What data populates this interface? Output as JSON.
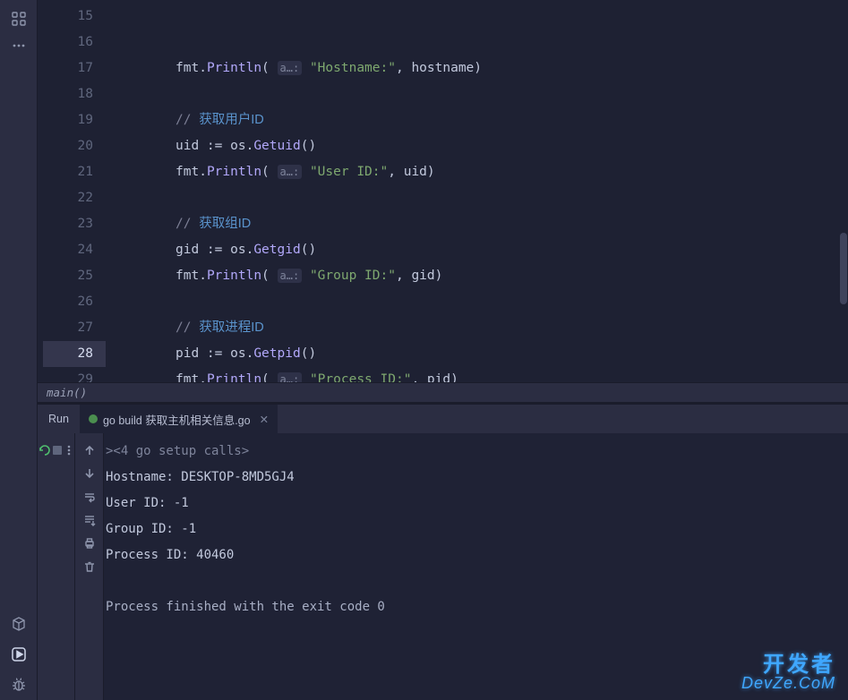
{
  "colors": {
    "background": "#1e2133",
    "panel": "#2b2d42",
    "currentLine": "#34364d",
    "accent": "#3fa7ff"
  },
  "leftbar": {
    "top_icons": [
      "grid-icon",
      "more-icon"
    ],
    "bottom_icons": [
      "db-icon",
      "play-icon",
      "bug-icon"
    ]
  },
  "editor": {
    "startLine": 15,
    "currentLine": 28,
    "breadcrumb": "main()",
    "hint_label": "a…:",
    "lines": [
      {
        "num": 15,
        "tokens": [
          {
            "t": "fmt",
            "c": "ident"
          },
          {
            "t": ".",
            "c": "op"
          },
          {
            "t": "Println",
            "c": "fn"
          },
          {
            "t": "(",
            "c": "paren"
          },
          {
            "t": " ",
            "c": "sp"
          },
          {
            "t": "a…:",
            "c": "hint"
          },
          {
            "t": " ",
            "c": "sp"
          },
          {
            "t": "\"Hostname:\"",
            "c": "str"
          },
          {
            "t": ", ",
            "c": "op"
          },
          {
            "t": "hostname",
            "c": "ident"
          },
          {
            "t": ")",
            "c": "paren"
          }
        ]
      },
      {
        "num": 16,
        "tokens": []
      },
      {
        "num": 17,
        "tokens": [
          {
            "t": "// ",
            "c": "comment"
          },
          {
            "t": "获取用户ID",
            "c": "comment-zh"
          }
        ]
      },
      {
        "num": 18,
        "tokens": [
          {
            "t": "uid ",
            "c": "ident"
          },
          {
            "t": ":= ",
            "c": "op"
          },
          {
            "t": "os",
            "c": "ident"
          },
          {
            "t": ".",
            "c": "op"
          },
          {
            "t": "Getuid",
            "c": "fn"
          },
          {
            "t": "()",
            "c": "paren"
          }
        ]
      },
      {
        "num": 19,
        "tokens": [
          {
            "t": "fmt",
            "c": "ident"
          },
          {
            "t": ".",
            "c": "op"
          },
          {
            "t": "Println",
            "c": "fn"
          },
          {
            "t": "(",
            "c": "paren"
          },
          {
            "t": " ",
            "c": "sp"
          },
          {
            "t": "a…:",
            "c": "hint"
          },
          {
            "t": " ",
            "c": "sp"
          },
          {
            "t": "\"User ID:\"",
            "c": "str"
          },
          {
            "t": ", ",
            "c": "op"
          },
          {
            "t": "uid",
            "c": "ident"
          },
          {
            "t": ")",
            "c": "paren"
          }
        ]
      },
      {
        "num": 20,
        "tokens": []
      },
      {
        "num": 21,
        "tokens": [
          {
            "t": "// ",
            "c": "comment"
          },
          {
            "t": "获取组ID",
            "c": "comment-zh"
          }
        ]
      },
      {
        "num": 22,
        "tokens": [
          {
            "t": "gid ",
            "c": "ident"
          },
          {
            "t": ":= ",
            "c": "op"
          },
          {
            "t": "os",
            "c": "ident"
          },
          {
            "t": ".",
            "c": "op"
          },
          {
            "t": "Getgid",
            "c": "fn"
          },
          {
            "t": "()",
            "c": "paren"
          }
        ]
      },
      {
        "num": 23,
        "tokens": [
          {
            "t": "fmt",
            "c": "ident"
          },
          {
            "t": ".",
            "c": "op"
          },
          {
            "t": "Println",
            "c": "fn"
          },
          {
            "t": "(",
            "c": "paren"
          },
          {
            "t": " ",
            "c": "sp"
          },
          {
            "t": "a…:",
            "c": "hint"
          },
          {
            "t": " ",
            "c": "sp"
          },
          {
            "t": "\"Group ID:\"",
            "c": "str"
          },
          {
            "t": ", ",
            "c": "op"
          },
          {
            "t": "gid",
            "c": "ident"
          },
          {
            "t": ")",
            "c": "paren"
          }
        ]
      },
      {
        "num": 24,
        "tokens": []
      },
      {
        "num": 25,
        "tokens": [
          {
            "t": "// ",
            "c": "comment"
          },
          {
            "t": "获取进程ID",
            "c": "comment-zh"
          }
        ]
      },
      {
        "num": 26,
        "tokens": [
          {
            "t": "pid ",
            "c": "ident"
          },
          {
            "t": ":= ",
            "c": "op"
          },
          {
            "t": "os",
            "c": "ident"
          },
          {
            "t": ".",
            "c": "op"
          },
          {
            "t": "Getpid",
            "c": "fn"
          },
          {
            "t": "()",
            "c": "paren"
          }
        ]
      },
      {
        "num": 27,
        "tokens": [
          {
            "t": "fmt",
            "c": "ident"
          },
          {
            "t": ".",
            "c": "op"
          },
          {
            "t": "Println",
            "c": "fn"
          },
          {
            "t": "(",
            "c": "paren"
          },
          {
            "t": " ",
            "c": "sp"
          },
          {
            "t": "a…:",
            "c": "hint"
          },
          {
            "t": " ",
            "c": "sp"
          },
          {
            "t": "\"Process ID:\"",
            "c": "str"
          },
          {
            "t": ", ",
            "c": "op"
          },
          {
            "t": "pid",
            "c": "ident"
          },
          {
            "t": ")",
            "c": "paren"
          }
        ]
      },
      {
        "num": 28,
        "current": true,
        "indent": 0,
        "tokens": [
          {
            "t": "}",
            "c": "paren"
          }
        ]
      },
      {
        "num": 29,
        "tokens": []
      }
    ]
  },
  "run": {
    "label": "Run",
    "tab_label": "go build 获取主机相关信息.go",
    "toolbar": [
      "rerun-icon",
      "stop-icon",
      "more-vertical-icon",
      "up-icon",
      "down-icon",
      "wrap-icon",
      "scroll-icon",
      "print-icon",
      "trash-icon"
    ],
    "output": [
      {
        "type": "setup",
        "text": "><4 go setup calls>"
      },
      {
        "type": "normal",
        "text": "Hostname: DESKTOP-8MD5GJ4"
      },
      {
        "type": "normal",
        "text": "User ID: -1"
      },
      {
        "type": "normal",
        "text": "Group ID: -1"
      },
      {
        "type": "normal",
        "text": "Process ID: 40460"
      },
      {
        "type": "blank",
        "text": ""
      },
      {
        "type": "exit",
        "text": "Process finished with the exit code 0"
      }
    ]
  },
  "watermark": {
    "zh": "开发者",
    "en": "DevZe.CoM"
  }
}
